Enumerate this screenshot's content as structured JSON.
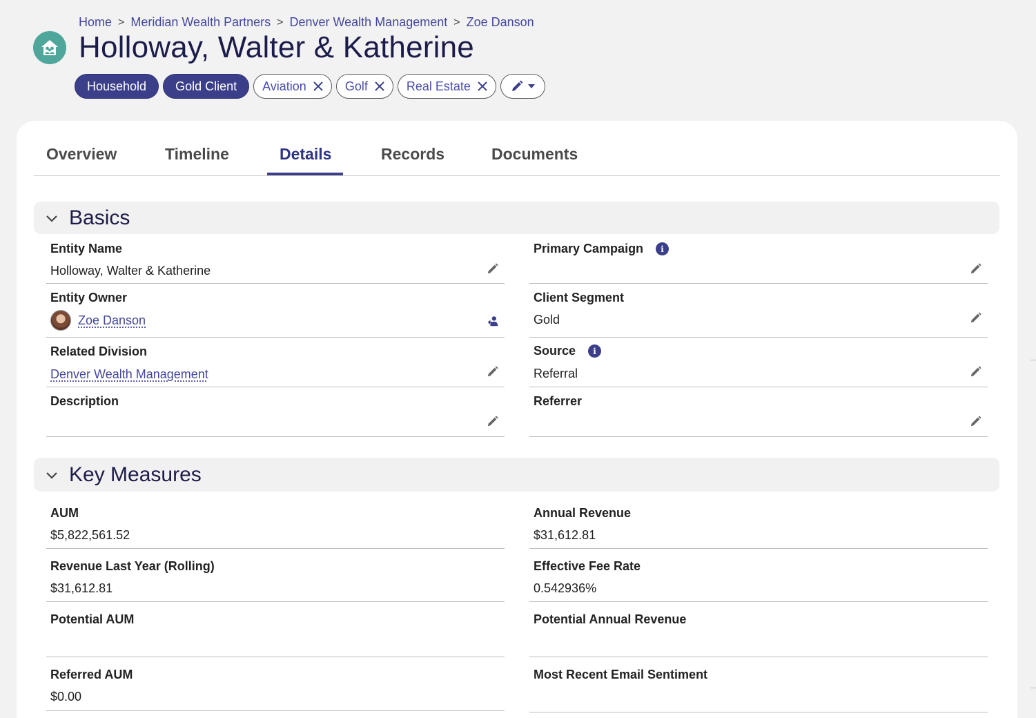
{
  "breadcrumb": [
    "Home",
    "Meridian Wealth Partners",
    "Denver Wealth Management",
    "Zoe Danson"
  ],
  "breadcrumb_sep": ">",
  "title": "Holloway, Walter & Katherine",
  "entity_icon": "household-icon",
  "tags": {
    "filled": [
      "Household",
      "Gold Client"
    ],
    "removable": [
      "Aviation",
      "Golf",
      "Real Estate"
    ]
  },
  "tabs": [
    "Overview",
    "Timeline",
    "Details",
    "Records",
    "Documents"
  ],
  "active_tab": "Details",
  "sections": {
    "basics": {
      "title": "Basics",
      "entity_name": {
        "label": "Entity Name",
        "value": "Holloway, Walter & Katherine"
      },
      "primary_campaign": {
        "label": "Primary Campaign",
        "value": ""
      },
      "entity_owner": {
        "label": "Entity Owner",
        "value": "Zoe Danson"
      },
      "client_segment": {
        "label": "Client Segment",
        "value": "Gold"
      },
      "related_division": {
        "label": "Related Division",
        "value": "Denver Wealth Management"
      },
      "source": {
        "label": "Source",
        "value": "Referral"
      },
      "description": {
        "label": "Description",
        "value": ""
      },
      "referrer": {
        "label": "Referrer",
        "value": ""
      }
    },
    "key_measures": {
      "title": "Key Measures",
      "aum": {
        "label": "AUM",
        "value": "$5,822,561.52"
      },
      "annual_revenue": {
        "label": "Annual Revenue",
        "value": "$31,612.81"
      },
      "revenue_last_year": {
        "label": "Revenue Last Year (Rolling)",
        "value": "$31,612.81"
      },
      "effective_fee_rate": {
        "label": "Effective Fee Rate",
        "value": "0.542936%"
      },
      "potential_aum": {
        "label": "Potential AUM",
        "value": ""
      },
      "potential_annual_revenue": {
        "label": "Potential Annual Revenue",
        "value": ""
      },
      "referred_aum": {
        "label": "Referred AUM",
        "value": "$0.00"
      },
      "email_sentiment": {
        "label": "Most Recent Email Sentiment",
        "value": ""
      }
    }
  },
  "colors": {
    "accent": "#3b3f8a",
    "icon_bg": "#4fa69b",
    "link": "#43479b"
  }
}
